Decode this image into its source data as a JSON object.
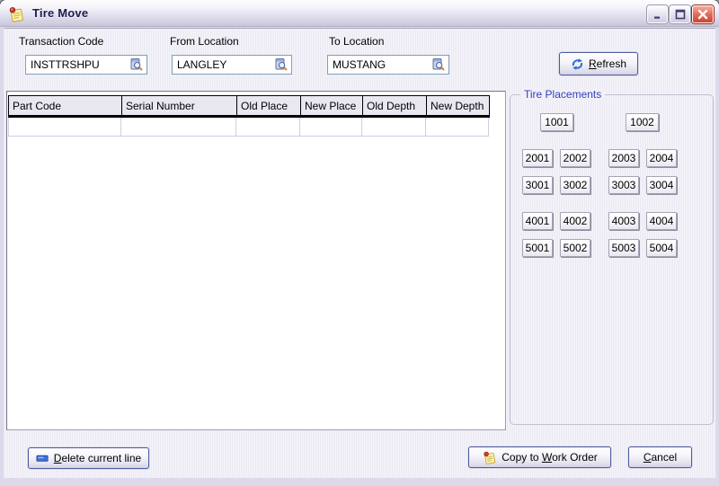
{
  "window": {
    "title": "Tire Move",
    "icon": "note-icon"
  },
  "titlebar_buttons": {
    "minimize": "minimize",
    "maximize": "maximize",
    "close": "close"
  },
  "fields": [
    {
      "label": "Transaction Code",
      "value": "INSTTRSHPU",
      "icon": "lookup-icon"
    },
    {
      "label": "From Location",
      "value": "LANGLEY",
      "icon": "lookup-icon"
    },
    {
      "label": "To Location",
      "value": "MUSTANG",
      "icon": "lookup-icon"
    }
  ],
  "buttons": {
    "refresh": {
      "pre": "",
      "accel": "R",
      "post": "efresh",
      "icon": "refresh-icon"
    },
    "delete_line": {
      "pre": "",
      "accel": "D",
      "post": "elete current line",
      "icon": "row-icon"
    },
    "copy_to_work_order": {
      "pre": "Copy to ",
      "accel": "W",
      "post": "ork Order",
      "icon": "note-icon"
    },
    "cancel": {
      "pre": "",
      "accel": "C",
      "post": "ancel"
    }
  },
  "table": {
    "columns": [
      "Part Code",
      "Serial Number",
      "Old Place",
      "New Place",
      "Old Depth",
      "New Depth"
    ],
    "rows": []
  },
  "tire_placements": {
    "title": "Tire Placements",
    "buttons": [
      "1001",
      "1002",
      "2001",
      "2002",
      "2003",
      "2004",
      "3001",
      "3002",
      "3003",
      "3004",
      "4001",
      "4002",
      "4003",
      "4004",
      "5001",
      "5002",
      "5003",
      "5004"
    ]
  },
  "colors": {
    "title_text": "#1c1c4e",
    "groupbox_label": "#3340bf",
    "xp_button_border": "#4d5c9b",
    "textbox_border": "#7f9db9",
    "close_button_red": "#cf4230",
    "refresh_icon_blue": "#2f6fd0",
    "dialog_bg": "#f1f0f7"
  }
}
